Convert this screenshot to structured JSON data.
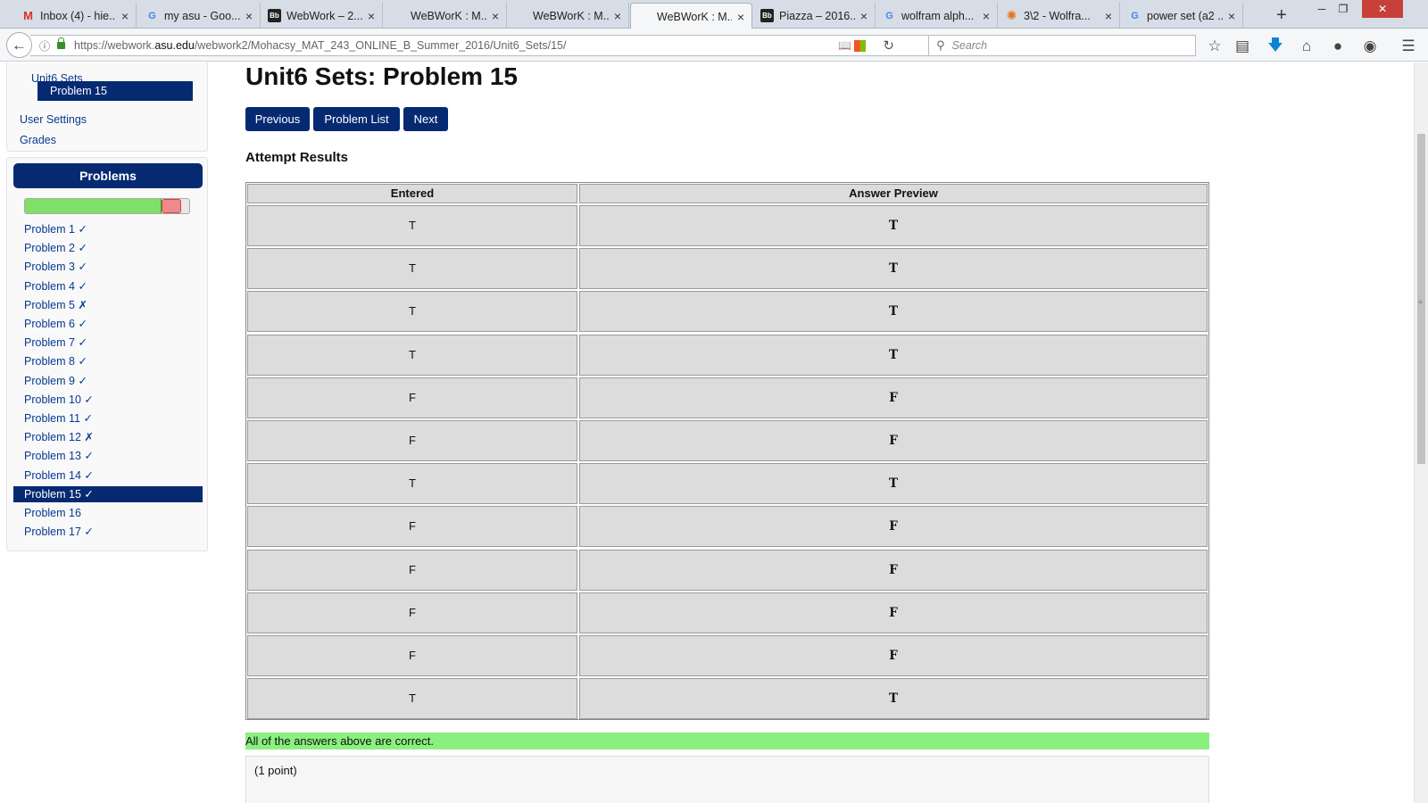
{
  "browser": {
    "tabs": [
      {
        "title": "Inbox (4) - hie...",
        "icon": "gmail-icon"
      },
      {
        "title": "my asu - Goo...",
        "icon": "google-icon"
      },
      {
        "title": "WebWork – 2...",
        "icon": "blackboard-icon"
      },
      {
        "title": "WeBWorK : M...",
        "icon": "blank-page-icon"
      },
      {
        "title": "WeBWorK : M...",
        "icon": "blank-page-icon"
      },
      {
        "title": "WeBWorK : M...",
        "icon": "blank-page-icon",
        "active": true
      },
      {
        "title": "Piazza – 2016...",
        "icon": "blackboard-icon"
      },
      {
        "title": "wolfram alph...",
        "icon": "google-icon"
      },
      {
        "title": "3\\2 - Wolfra...",
        "icon": "wolfram-icon"
      },
      {
        "title": "power set (a2 ...",
        "icon": "google-icon"
      }
    ],
    "url_prefix": "https://webwork.",
    "url_host": "asu.edu",
    "url_path": "/webwork2/Mohacsy_MAT_243_ONLINE_B_Summer_2016/Unit6_Sets/15/",
    "search_placeholder": "Search"
  },
  "sidebar": {
    "links": {
      "unit6_sets": "Unit6 Sets",
      "problem15": "Problem 15",
      "user_settings": "User Settings",
      "grades": "Grades"
    },
    "problems_header": "Problems",
    "progress": {
      "correct_fraction": 0.82,
      "incorrect_fraction": 0.12
    },
    "problems": [
      {
        "label": "Problem 1 ✓"
      },
      {
        "label": "Problem 2 ✓"
      },
      {
        "label": "Problem 3 ✓"
      },
      {
        "label": "Problem 4 ✓"
      },
      {
        "label": "Problem 5 ✗"
      },
      {
        "label": "Problem 6 ✓"
      },
      {
        "label": "Problem 7 ✓"
      },
      {
        "label": "Problem 8 ✓"
      },
      {
        "label": "Problem 9 ✓"
      },
      {
        "label": "Problem 10 ✓"
      },
      {
        "label": "Problem 11 ✓"
      },
      {
        "label": "Problem 12 ✗"
      },
      {
        "label": "Problem 13 ✓"
      },
      {
        "label": "Problem 14 ✓"
      },
      {
        "label": "Problem 15 ✓",
        "active": true
      },
      {
        "label": "Problem 16"
      },
      {
        "label": "Problem 17 ✓"
      }
    ]
  },
  "main": {
    "title": "Unit6 Sets: Problem 15",
    "buttons": {
      "previous": "Previous",
      "problem_list": "Problem List",
      "next": "Next"
    },
    "attempt_heading": "Attempt Results",
    "table": {
      "headers": [
        "Entered",
        "Answer Preview"
      ],
      "rows": [
        [
          "T",
          "T"
        ],
        [
          "T",
          "T"
        ],
        [
          "T",
          "T"
        ],
        [
          "T",
          "T"
        ],
        [
          "F",
          "F"
        ],
        [
          "F",
          "F"
        ],
        [
          "T",
          "T"
        ],
        [
          "F",
          "F"
        ],
        [
          "F",
          "F"
        ],
        [
          "F",
          "F"
        ],
        [
          "F",
          "F"
        ],
        [
          "T",
          "T"
        ]
      ]
    },
    "correct_message": "All of the answers above are correct.",
    "points": "(1 point)"
  },
  "colors": {
    "nav_blue": "#062a72",
    "link_blue": "#08398e",
    "correct_green": "#8bf07f",
    "progress_green": "#7ee067",
    "progress_red": "#f08a8a"
  }
}
